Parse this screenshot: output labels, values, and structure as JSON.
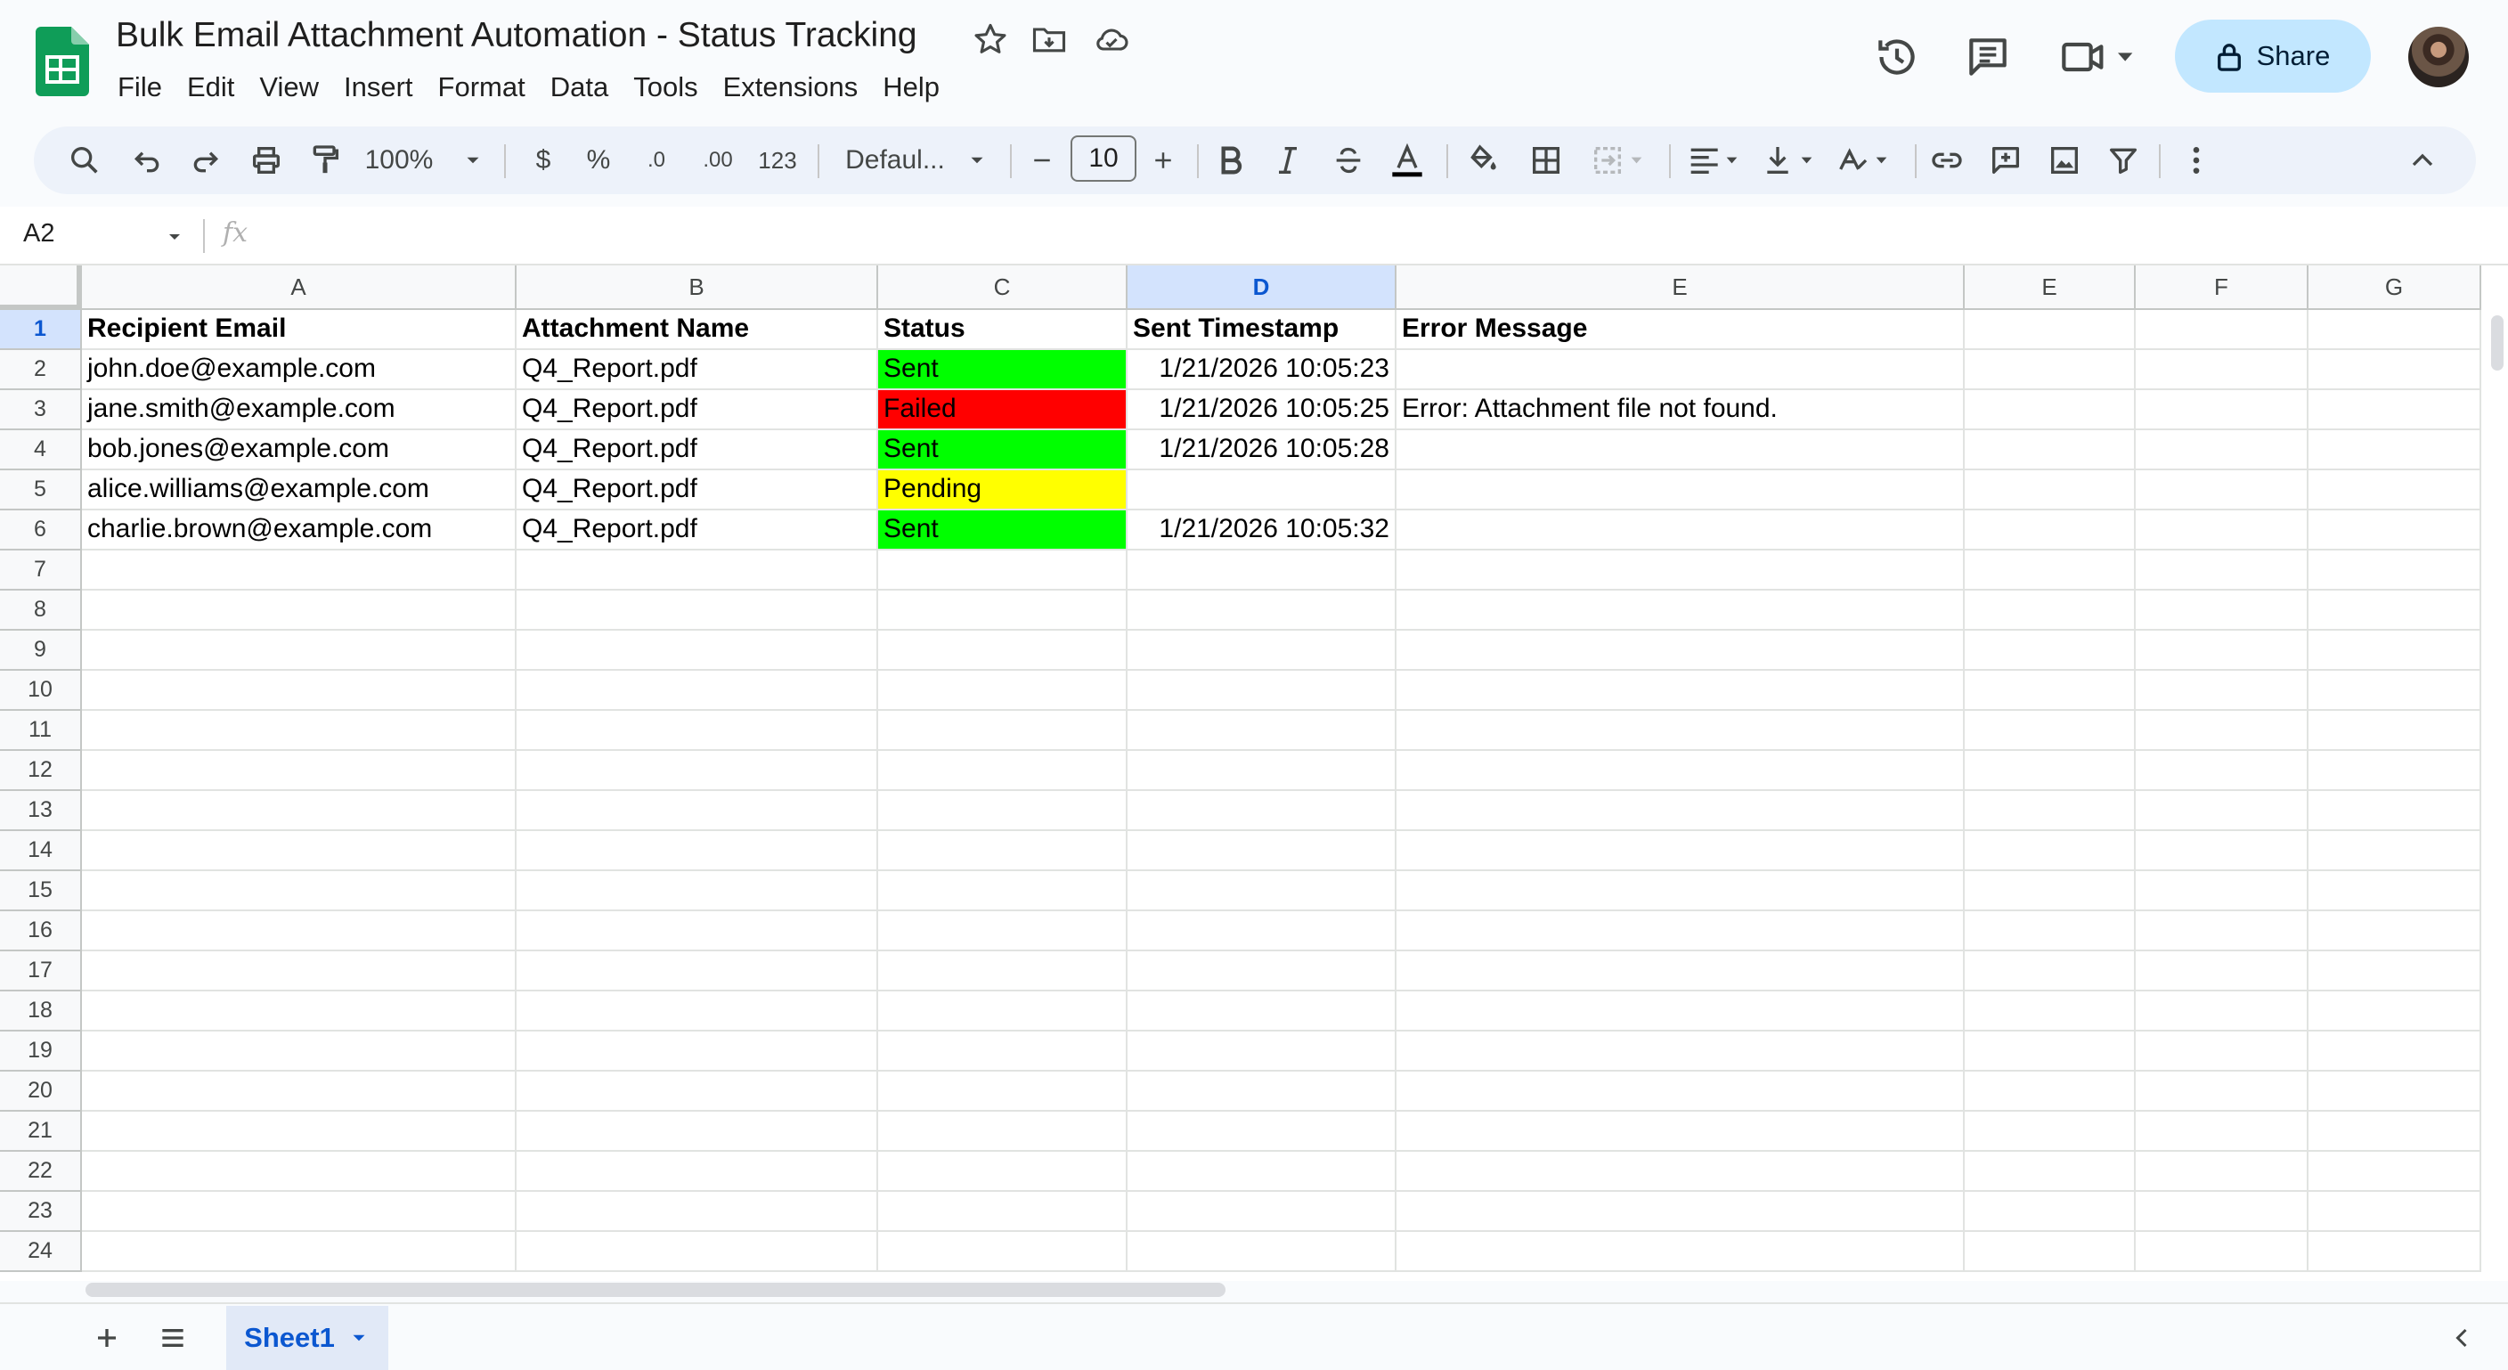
{
  "document": {
    "title": "Bulk Email Attachment Automation - Status Tracking",
    "icons": [
      "star-icon",
      "move-to-folder-icon",
      "cloud-saved-icon"
    ]
  },
  "menu": [
    "File",
    "Edit",
    "View",
    "Insert",
    "Format",
    "Data",
    "Tools",
    "Extensions",
    "Help"
  ],
  "header_actions": {
    "icons": [
      "version-history-icon",
      "comments-icon",
      "meet-video-icon"
    ],
    "share_label": "Share"
  },
  "toolbar": {
    "zoom": "100%",
    "currency": "$",
    "percent": "%",
    "decrease_decimal": ".0",
    "increase_decimal": ".00",
    "number_format": "123",
    "font": "Defaul...",
    "font_size": "10",
    "icons": [
      "search-icon",
      "undo-icon",
      "redo-icon",
      "print-icon",
      "paint-format-icon",
      "bold-icon",
      "italic-icon",
      "strikethrough-icon",
      "text-color-icon",
      "fill-color-icon",
      "borders-icon",
      "merge-cells-icon",
      "align-icon",
      "vertical-align-icon",
      "text-rotation-icon",
      "link-icon",
      "comment-icon",
      "image-icon",
      "filter-icon",
      "more-icon",
      "collapse-icon"
    ]
  },
  "formula_bar": {
    "name_box": "A2",
    "fx_label": "fx",
    "content": ""
  },
  "columns": [
    "A",
    "B",
    "C",
    "D",
    "E",
    "E",
    "F",
    "G"
  ],
  "selected_column": "D",
  "rows": [
    "1",
    "2",
    "3",
    "4",
    "5",
    "6",
    "7",
    "8",
    "9",
    "10",
    "11",
    "12",
    "13",
    "14",
    "15",
    "16",
    "17",
    "18",
    "19",
    "20",
    "21",
    "22",
    "23",
    "24"
  ],
  "table": {
    "header": [
      "Recipient Email",
      "Attachment Name",
      "Status",
      "Sent Timestamp",
      "Error Message"
    ],
    "data": [
      [
        "john.doe@example.com",
        "Q4_Report.pdf",
        "Sent",
        "1/21/2026 10:05:23",
        ""
      ],
      [
        "jane.smith@example.com",
        "Q4_Report.pdf",
        "Failed",
        "1/21/2026 10:05:25",
        "Error: Attachment file not found."
      ],
      [
        "bob.jones@example.com",
        "Q4_Report.pdf",
        "Sent",
        "1/21/2026 10:05:28",
        ""
      ],
      [
        "alice.williams@example.com",
        "Q4_Report.pdf",
        "Pending",
        "",
        ""
      ],
      [
        "charlie.brown@example.com",
        "Q4_Report.pdf",
        "Sent",
        "1/21/2026 10:05:32",
        ""
      ]
    ]
  },
  "status_colors": {
    "Sent": "#00ff00",
    "Failed": "#ff0000",
    "Pending": "#ffff00"
  },
  "sheets": {
    "add_icon": "plus-icon",
    "list_icon": "all-sheets-icon",
    "active_tab": "Sheet1"
  }
}
